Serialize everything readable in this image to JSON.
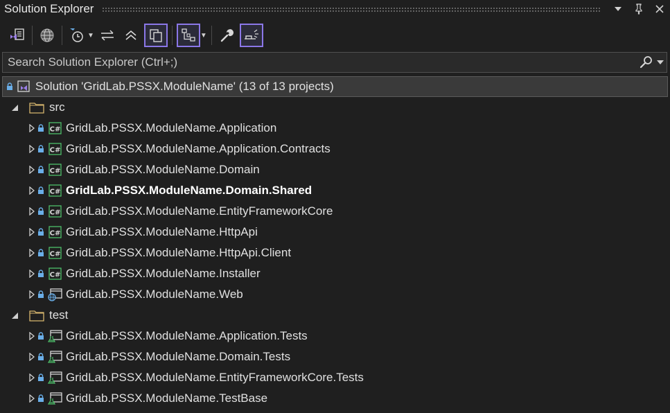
{
  "window": {
    "title": "Solution Explorer"
  },
  "search": {
    "placeholder": "Search Solution Explorer (Ctrl+;)"
  },
  "solution": {
    "label": "Solution 'GridLab.PSSX.ModuleName' (13 of 13 projects)"
  },
  "folders": [
    {
      "name": "src",
      "projects": [
        {
          "name": "GridLab.PSSX.ModuleName.Application",
          "type": "csharp",
          "bold": false
        },
        {
          "name": "GridLab.PSSX.ModuleName.Application.Contracts",
          "type": "csharp",
          "bold": false
        },
        {
          "name": "GridLab.PSSX.ModuleName.Domain",
          "type": "csharp",
          "bold": false
        },
        {
          "name": "GridLab.PSSX.ModuleName.Domain.Shared",
          "type": "csharp",
          "bold": true
        },
        {
          "name": "GridLab.PSSX.ModuleName.EntityFrameworkCore",
          "type": "csharp",
          "bold": false
        },
        {
          "name": "GridLab.PSSX.ModuleName.HttpApi",
          "type": "csharp",
          "bold": false
        },
        {
          "name": "GridLab.PSSX.ModuleName.HttpApi.Client",
          "type": "csharp",
          "bold": false
        },
        {
          "name": "GridLab.PSSX.ModuleName.Installer",
          "type": "csharp",
          "bold": false
        },
        {
          "name": "GridLab.PSSX.ModuleName.Web",
          "type": "web",
          "bold": false
        }
      ]
    },
    {
      "name": "test",
      "projects": [
        {
          "name": "GridLab.PSSX.ModuleName.Application.Tests",
          "type": "test",
          "bold": false
        },
        {
          "name": "GridLab.PSSX.ModuleName.Domain.Tests",
          "type": "test",
          "bold": false
        },
        {
          "name": "GridLab.PSSX.ModuleName.EntityFrameworkCore.Tests",
          "type": "test",
          "bold": false
        },
        {
          "name": "GridLab.PSSX.ModuleName.TestBase",
          "type": "test",
          "bold": false
        }
      ]
    }
  ],
  "colors": {
    "background": "#1f1f1f",
    "accent": "#8b77e8",
    "csharp": "#4ec06a",
    "lock": "#6aaee8",
    "folder": "#d7b66e"
  }
}
